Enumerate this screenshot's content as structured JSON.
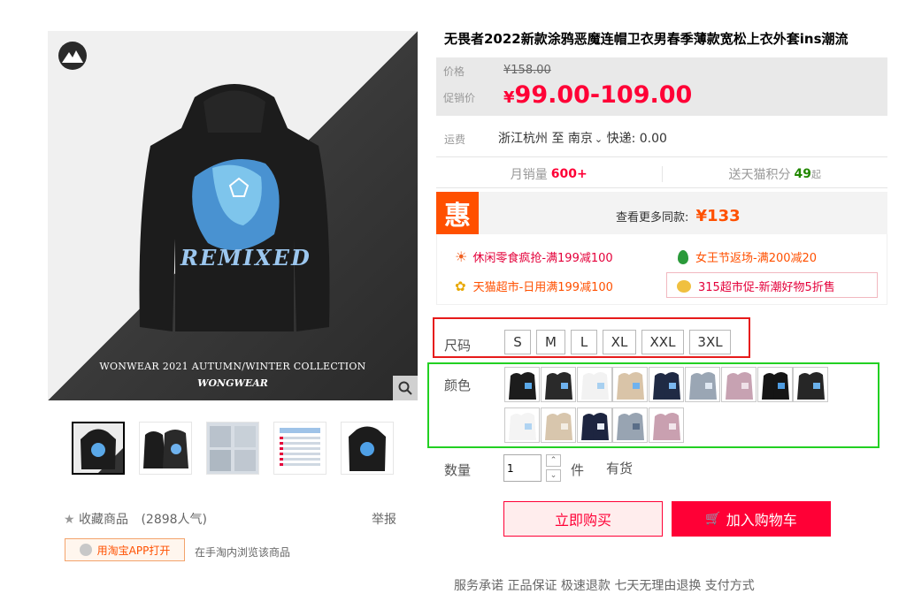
{
  "product": {
    "title": "无畏者2022新款涂鸦恶魔连帽卫衣男春季薄款宽松上衣外套ins潮流",
    "image_text": {
      "remixed": "REMIXED",
      "collection": "WONWEAR 2021 AUTUMN/WINTER COLLECTION",
      "brand": "WONGWEAR"
    }
  },
  "price": {
    "label": "价格",
    "original": "¥158.00",
    "promo_label": "促销价",
    "currency": "¥",
    "promo": "99.00-109.00"
  },
  "shipping": {
    "label": "运费",
    "from": "浙江杭州",
    "to_word": "至",
    "to": "南京",
    "express": "快递: 0.00"
  },
  "sales": {
    "monthly_label": "月销量",
    "monthly_value": "600+",
    "points_label": "送天猫积分",
    "points_value": "49",
    "points_suffix": "起"
  },
  "promo": {
    "badge": "惠",
    "more_label": "查看更多同款:",
    "more_price": "¥133",
    "items": [
      {
        "text": "休闲零食疯抢-满199减100",
        "icon": "sun-icon",
        "color": "#e4003a"
      },
      {
        "text": "女王节返场-满200减20",
        "icon": "leaf-icon",
        "color": "#ff5000"
      },
      {
        "text": "天猫超市-日用满199减100",
        "icon": "flower-icon",
        "color": "#ff5000"
      },
      {
        "text": "315超市促-新潮好物5折售",
        "icon": "bear-icon",
        "color": "#e4003a"
      }
    ]
  },
  "size": {
    "label": "尺码",
    "options": [
      "S",
      "M",
      "L",
      "XL",
      "XXL",
      "3XL"
    ]
  },
  "color": {
    "label": "颜色",
    "swatches": [
      {
        "bg": "#1c1c1c",
        "art": "#5aa8e8"
      },
      {
        "bg": "#2a2a2a",
        "art": "#6fb2ee"
      },
      {
        "bg": "#f2f2f2",
        "art": "#a8d0f0"
      },
      {
        "bg": "#d9c4a8",
        "art": "#6fb2ee"
      },
      {
        "bg": "#1f2a44",
        "art": "#7ab8f0"
      },
      {
        "bg": "#9aa6b4",
        "art": "#dfe8f2"
      },
      {
        "bg": "#c7a2b2",
        "art": "#efe0e8"
      },
      {
        "bg": "#151515",
        "art": "#4e9be0"
      },
      {
        "bg": "#262626",
        "art": "#6ab0ea"
      },
      {
        "bg": "#f4f4f4",
        "art": "#b0d4f2"
      },
      {
        "bg": "#d8c6ad",
        "art": "#f3ede4"
      },
      {
        "bg": "#1d2540",
        "art": "#e8eef8"
      },
      {
        "bg": "#98a4b2",
        "art": "#5a6e88"
      },
      {
        "bg": "#c9a0b0",
        "art": "#f2e6ec"
      }
    ]
  },
  "quantity": {
    "label": "数量",
    "value": "1",
    "unit": "件",
    "stock": "有货"
  },
  "actions": {
    "buy_now": "立即购买",
    "add_cart": "加入购物车"
  },
  "left_bottom": {
    "favorite": "收藏商品",
    "popularity": "(2898人气)",
    "report": "举报",
    "app_button": "用淘宝APP打开",
    "app_hint": "在手淘内浏览该商品"
  },
  "bottom_tabs": "服务承诺  正品保证    极速退款    七天无理由退换         支付方式",
  "colors": {
    "accent": "#ff0036",
    "orange": "#ff5000",
    "green": "#22d022",
    "red_frame": "#e61b1b"
  }
}
